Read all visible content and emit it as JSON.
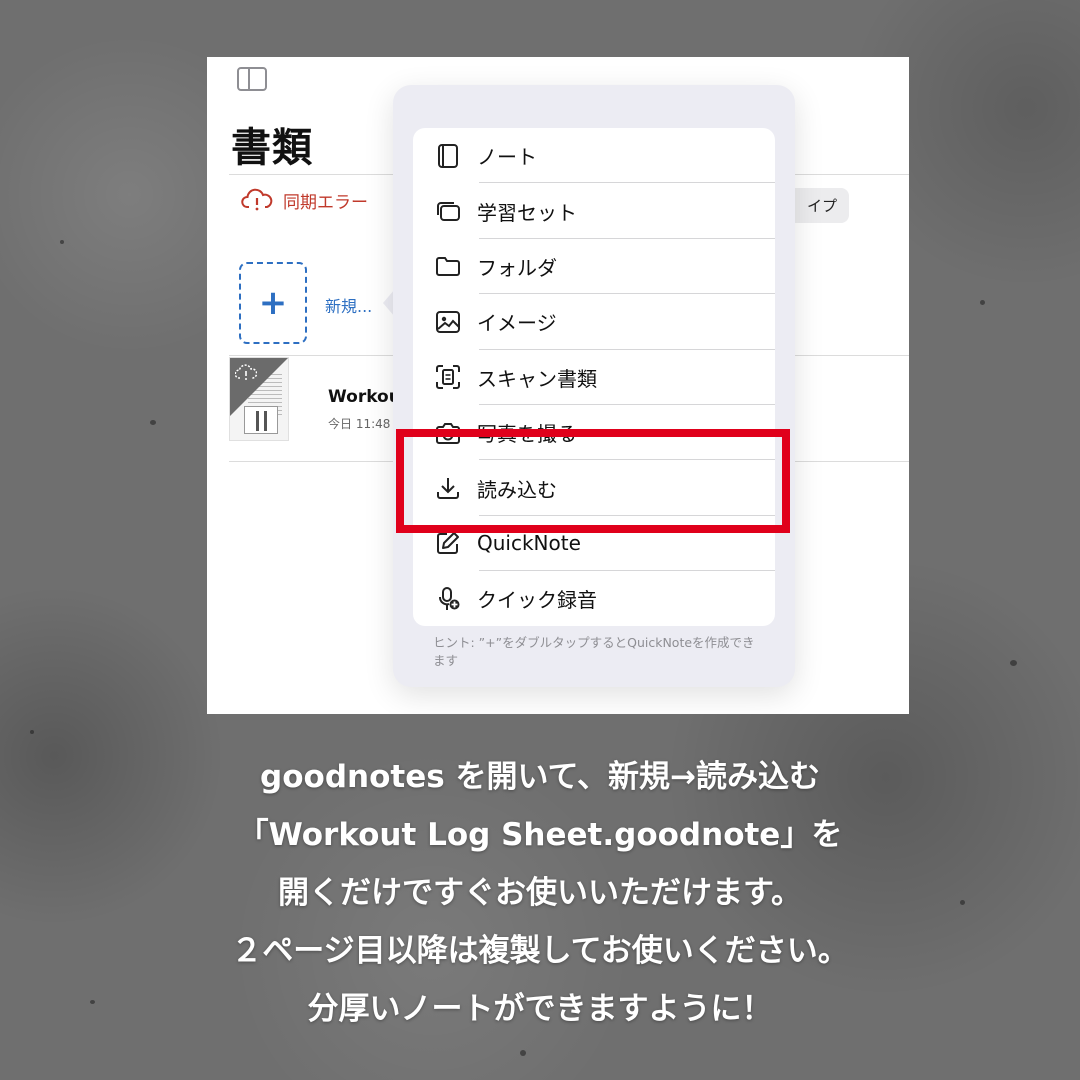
{
  "screen": {
    "page_title": "書類",
    "sync_error_label": "同期エラー",
    "type_chip_label": "イプ",
    "new_tile_symbol": "+",
    "new_label": "新規...",
    "document": {
      "name": "Workout",
      "time": "今日 11:48"
    }
  },
  "menu": {
    "items": [
      {
        "label": "ノート",
        "icon": "notebook-icon"
      },
      {
        "label": "学習セット",
        "icon": "stacked-cards-icon"
      },
      {
        "label": "フォルダ",
        "icon": "folder-icon"
      },
      {
        "label": "イメージ",
        "icon": "image-icon"
      },
      {
        "label": "スキャン書類",
        "icon": "scan-icon"
      },
      {
        "label": "写真を撮る",
        "icon": "camera-icon"
      },
      {
        "label": "読み込む",
        "icon": "import-icon"
      },
      {
        "label": "QuickNote",
        "icon": "pencil-square-icon"
      },
      {
        "label": "クイック録音",
        "icon": "microphone-plus-icon"
      }
    ],
    "hint": "ヒント: ”+”をダブルタップするとQuickNoteを作成できます"
  },
  "highlight_color": "#e0001b",
  "caption": {
    "line1": "goodnotes を開いて、新規→読み込む",
    "line2": "「Workout Log Sheet.goodnote」を",
    "line3": "開くだけですぐお使いいただけます。",
    "line4": "２ページ目以降は複製してお使いください。",
    "line5": "分厚いノートができますように！"
  }
}
